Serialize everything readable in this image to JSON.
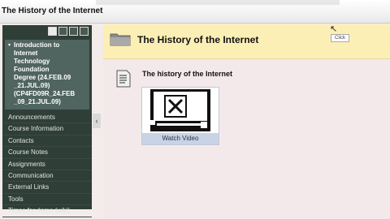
{
  "window": {
    "title": "The History of the Internet"
  },
  "sidebar": {
    "toolbar": [
      {
        "icon": "list-view-icon"
      },
      {
        "icon": "folder-view-icon"
      },
      {
        "icon": "tree-view-icon"
      },
      {
        "icon": "edit-icon"
      }
    ],
    "course_name": "Introduction to\nInternet\nTechnology\nFoundation\nDegree (24.FEB.09\n_21.JUL.09)\n(CP4FD09R_24.FEB\n_09_21.JUL.09)",
    "menu": [
      "Announcements",
      "Course Information",
      "Contacts",
      "Course Notes",
      "Assignments",
      "Communication",
      "External Links",
      "Tools",
      "Times for demo (wiki)"
    ]
  },
  "page": {
    "title": "The History of the Internet",
    "item_title": "The history of the Internet",
    "video_button": "Watch Video",
    "tooltip": "Click"
  },
  "colors": {
    "sidebar_bg": "#2f3e37",
    "page_header_bg": "#fcefb6",
    "content_bg": "#f4e9ea"
  }
}
